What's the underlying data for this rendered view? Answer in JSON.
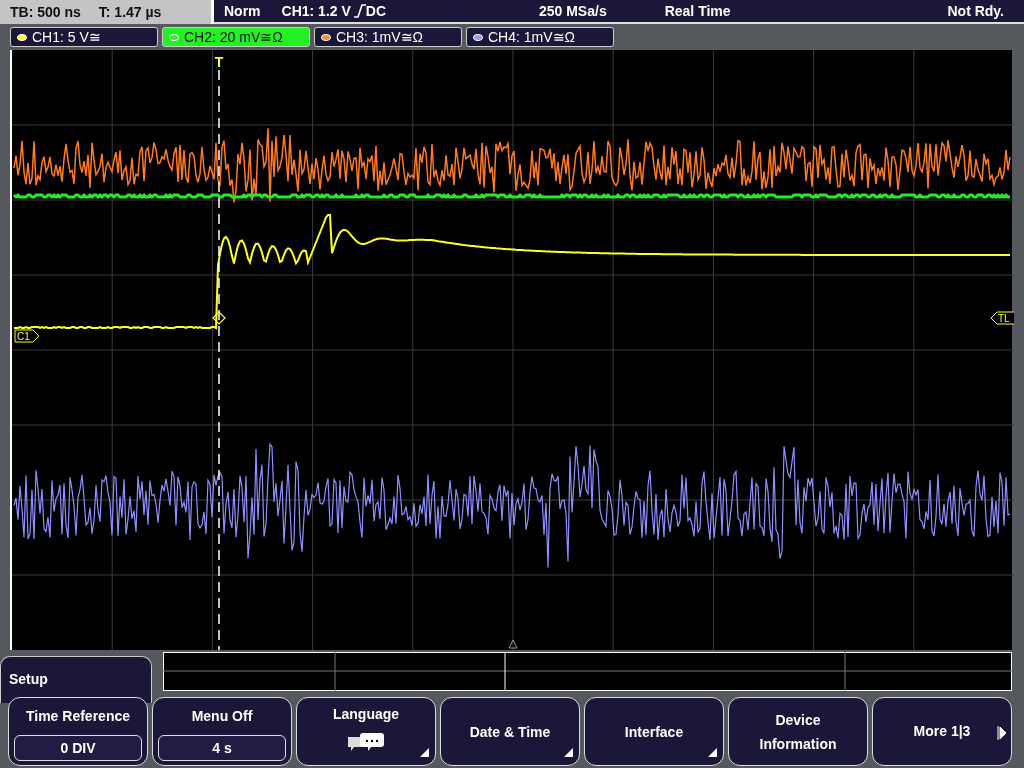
{
  "status_bar": {
    "timebase": "TB: 500 ns",
    "trigger_time": "T: 1.47 µs",
    "trigger_mode": "Norm",
    "trigger_level": "CH1: 1.2 V",
    "coupling": "DC",
    "sample_rate": "250 MSa/s",
    "acquisition": "Real Time",
    "state": "Not Rdy."
  },
  "channels": [
    {
      "label": "CH1: 5 V≅",
      "color": "#ffff33",
      "selected": false
    },
    {
      "label": "CH2: 20 mV≅Ω",
      "color": "#33ee33",
      "selected": true
    },
    {
      "label": "CH3: 1mV≅Ω",
      "color": "#ff8833",
      "selected": false
    },
    {
      "label": "CH4: 1mV≅Ω",
      "color": "#9999ff",
      "selected": false
    }
  ],
  "markers": {
    "trigger": "T",
    "ch1": "C1",
    "trigger_level": "TL"
  },
  "menu": {
    "title": "Setup",
    "softkeys": [
      {
        "label": "Time Reference",
        "kind": "value",
        "value": "0 DIV",
        "submenu": false
      },
      {
        "label": "Menu Off",
        "kind": "value",
        "value": "4 s",
        "submenu": false
      },
      {
        "label": "Language",
        "kind": "icon",
        "submenu": true
      },
      {
        "label": "Date & Time",
        "kind": "plain",
        "submenu": true
      },
      {
        "label": "Interface",
        "kind": "plain",
        "submenu": true
      },
      {
        "label": "Device Information",
        "kind": "plain",
        "submenu": false
      },
      {
        "label": "More 1|3",
        "kind": "next",
        "submenu": false
      }
    ]
  }
}
